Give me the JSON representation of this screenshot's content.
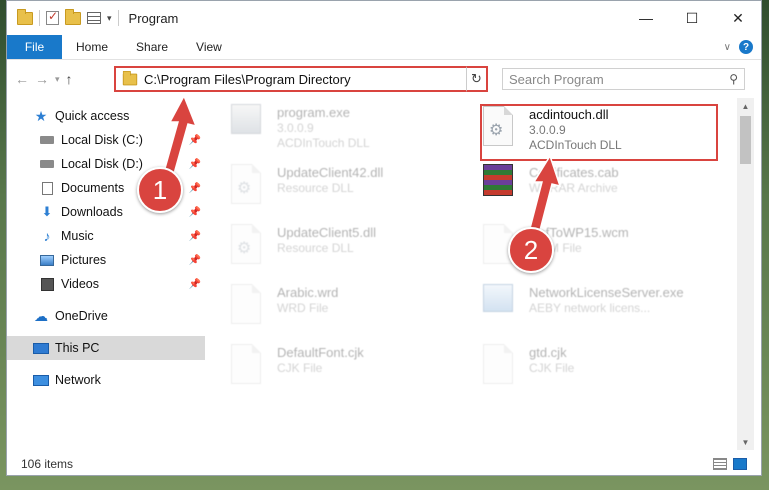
{
  "window": {
    "title": "Program",
    "controls": {
      "minimize": "—",
      "maximize": "☐",
      "close": "✕"
    }
  },
  "ribbon": {
    "file": "File",
    "tabs": [
      "Home",
      "Share",
      "View"
    ]
  },
  "address": {
    "path": "C:\\Program Files\\Program Directory",
    "search_placeholder": "Search Program"
  },
  "sidebar": {
    "quick_access": "Quick access",
    "items": [
      {
        "label": "Local Disk (C:)",
        "icon": "disk-icon"
      },
      {
        "label": "Local Disk (D:)",
        "icon": "disk-icon"
      },
      {
        "label": "Documents",
        "icon": "documents-icon"
      },
      {
        "label": "Downloads",
        "icon": "downloads-icon"
      },
      {
        "label": "Music",
        "icon": "music-icon"
      },
      {
        "label": "Pictures",
        "icon": "pictures-icon"
      },
      {
        "label": "Videos",
        "icon": "videos-icon"
      }
    ],
    "onedrive": "OneDrive",
    "this_pc": "This PC",
    "network": "Network"
  },
  "files": {
    "left": [
      {
        "name": "program.exe",
        "line1": "3.0.0.9",
        "line2": "ACDInTouch DLL"
      },
      {
        "name": "UpdateClient42.dll",
        "line1": "Resource DLL"
      },
      {
        "name": "UpdateClient5.dll",
        "line1": "Resource DLL"
      },
      {
        "name": "Arabic.wrd",
        "line1": "WRD File"
      },
      {
        "name": "DefaultFont.cjk",
        "line1": "CJK File"
      }
    ],
    "right": [
      {
        "name": "acdintouch.dll",
        "line1": "3.0.0.9",
        "line2": "ACDInTouch DLL"
      },
      {
        "name": "Certificates.cab",
        "line1": "WinRAR Archive"
      },
      {
        "name": "DefToWP15.wcm",
        "line1": "WCM File"
      },
      {
        "name": "NetworkLicenseServer.exe",
        "line1": "AEBY network licens..."
      },
      {
        "name": "gtd.cjk",
        "line1": "CJK File"
      }
    ]
  },
  "status": {
    "count": "106 items"
  },
  "markers": {
    "one": "1",
    "two": "2"
  },
  "colors": {
    "accent": "#1979ca",
    "highlight": "#d9443f"
  }
}
